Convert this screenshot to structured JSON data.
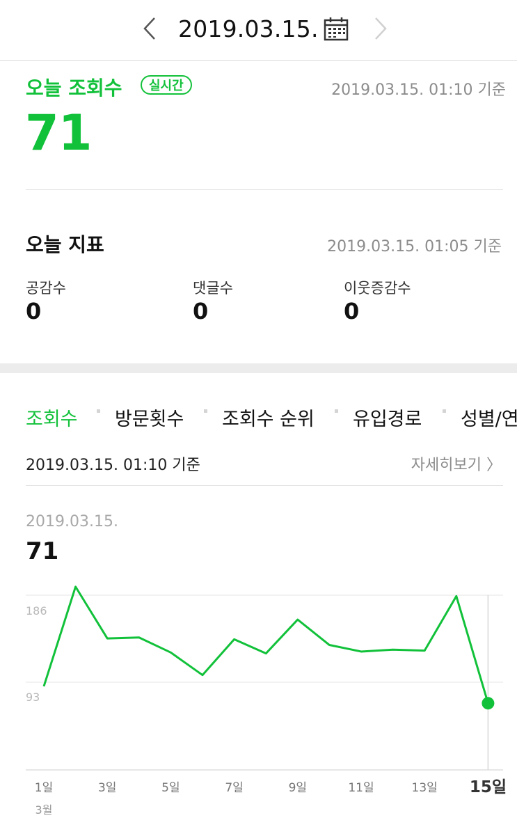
{
  "header": {
    "title": "2019.03.15.",
    "prev_icon": "chevron-left-icon",
    "next_icon": "chevron-right-icon",
    "calendar_icon": "calendar-icon"
  },
  "today": {
    "label": "오늘 조회수",
    "badge": "실시간",
    "timestamp": "2019.03.15. 01:10 기준",
    "count": "71"
  },
  "metrics": {
    "title": "오늘 지표",
    "timestamp": "2019.03.15. 01:05 기준",
    "items": [
      {
        "label": "공감수",
        "value": "0"
      },
      {
        "label": "댓글수",
        "value": "0"
      },
      {
        "label": "이웃증감수",
        "value": "0"
      }
    ]
  },
  "tabs": [
    {
      "label": "조회수",
      "active": true
    },
    {
      "label": "방문횟수",
      "active": false
    },
    {
      "label": "조회수 순위",
      "active": false
    },
    {
      "label": "유입경로",
      "active": false
    },
    {
      "label": "성별/연",
      "active": false
    }
  ],
  "stats": {
    "timestamp": "2019.03.15. 01:10 기준",
    "detail_link": "자세히보기 〉",
    "selected_date": "2019.03.15.",
    "selected_value": "71"
  },
  "colors": {
    "accent": "#12c13a",
    "muted": "#8c8c8c"
  },
  "chart_data": {
    "type": "line",
    "x": [
      "1일",
      "2일",
      "3일",
      "4일",
      "5일",
      "6일",
      "7일",
      "8일",
      "9일",
      "10일",
      "11일",
      "12일",
      "13일",
      "14일",
      "15일"
    ],
    "xtick_labels": [
      "1일",
      "3일",
      "5일",
      "7일",
      "9일",
      "11일",
      "13일",
      "15일"
    ],
    "xtick_indices": [
      0,
      2,
      4,
      6,
      8,
      10,
      12,
      14
    ],
    "month_label": "3월",
    "series": [
      {
        "values": [
          89,
          195,
          140,
          141,
          125,
          101,
          139,
          124,
          160,
          133,
          126,
          128,
          127,
          185,
          71
        ]
      }
    ],
    "yticks": [
      93,
      186
    ],
    "ylim": [
      0,
      186
    ],
    "highlight_index": 14,
    "grid": true
  }
}
